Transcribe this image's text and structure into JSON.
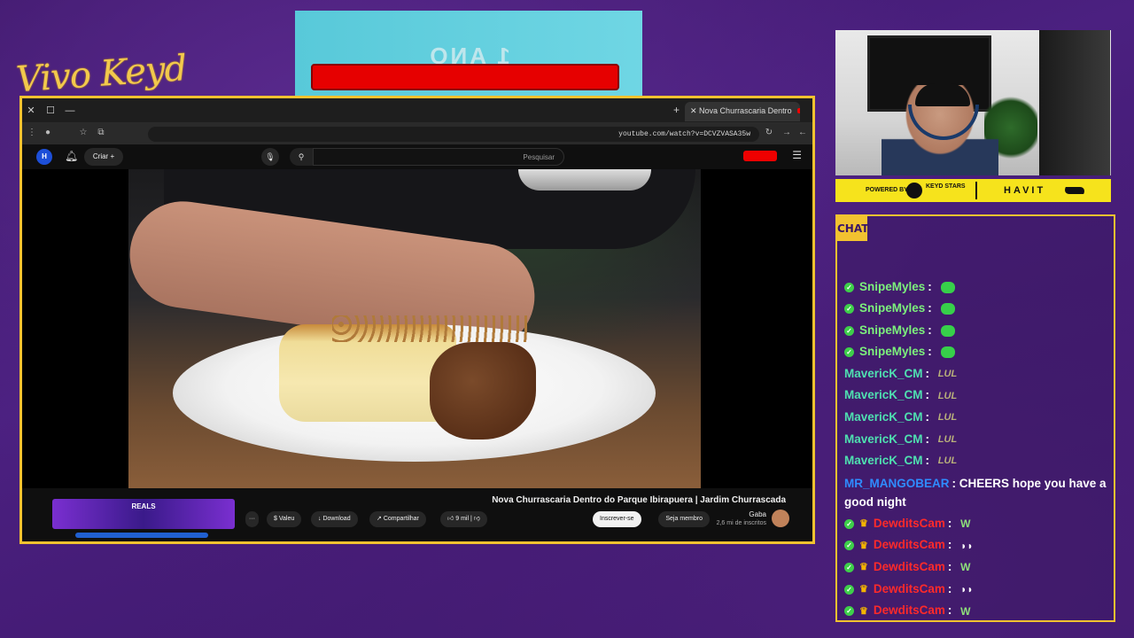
{
  "overlay": {
    "brand_text": "Vivo Keyd Stars",
    "banner_text": "1 ANO",
    "powered_label": "POWERED BY",
    "powered_brand": "KEYD STARS",
    "sponsor": "HAVIT",
    "chat_title": "CHAT",
    "accent_color": "#f2c230"
  },
  "browser": {
    "tab_title": "Nova Churrascaria Dentro",
    "url": "youtube.com/watch?v=DCVZVASA35w",
    "search_placeholder": "Pesquisar",
    "create_label": "Criar",
    "video_title": "Nova Churrascaria Dentro do Parque Ibirapuera | Jardim Churrascada",
    "channel_name": "Gaba",
    "channel_subs": "2,6 mi de inscritos",
    "actions": {
      "subscribe": "Inscrever-se",
      "member": "Seja membro",
      "likes": "9 mil",
      "share": "Compartilhar",
      "download": "Download",
      "thanks": "Valeu",
      "more": "···"
    },
    "promo_title": "REALS"
  },
  "chat": {
    "messages": [
      {
        "user": "SnipeMyles",
        "color": "#7cf07c",
        "badge": "check",
        "text": "",
        "emote": "green"
      },
      {
        "user": "SnipeMyles",
        "color": "#7cf07c",
        "badge": "check",
        "text": "",
        "emote": "green"
      },
      {
        "user": "SnipeMyles",
        "color": "#7cf07c",
        "badge": "check",
        "text": "",
        "emote": "green"
      },
      {
        "user": "SnipeMyles",
        "color": "#7cf07c",
        "badge": "check",
        "text": "",
        "emote": "green"
      },
      {
        "user": "MavericK_CM",
        "color": "#4fe0b0",
        "badge": "",
        "text": "",
        "emote": "lul"
      },
      {
        "user": "MavericK_CM",
        "color": "#4fe0b0",
        "badge": "",
        "text": "",
        "emote": "lul"
      },
      {
        "user": "MavericK_CM",
        "color": "#4fe0b0",
        "badge": "",
        "text": "",
        "emote": "lul"
      },
      {
        "user": "MavericK_CM",
        "color": "#4fe0b0",
        "badge": "",
        "text": "",
        "emote": "lul"
      },
      {
        "user": "MavericK_CM",
        "color": "#4fe0b0",
        "badge": "",
        "text": "",
        "emote": "lul"
      },
      {
        "user": "MR_MANGOBEAR",
        "color": "#2f8cff",
        "badge": "",
        "text": "CHEERS hope you have a good night",
        "emote": ""
      },
      {
        "user": "DewditsCam",
        "color": "#ff2a2a",
        "badge": "check-crown",
        "text": "",
        "emote": "w"
      },
      {
        "user": "DewditsCam",
        "color": "#ff2a2a",
        "badge": "check-crown",
        "text": "",
        "emote": "eyes"
      },
      {
        "user": "DewditsCam",
        "color": "#ff2a2a",
        "badge": "check-crown",
        "text": "",
        "emote": "w"
      },
      {
        "user": "DewditsCam",
        "color": "#ff2a2a",
        "badge": "check-crown",
        "text": "",
        "emote": "eyes"
      },
      {
        "user": "DewditsCam",
        "color": "#ff2a2a",
        "badge": "check-crown",
        "text": "",
        "emote": "w"
      }
    ]
  }
}
